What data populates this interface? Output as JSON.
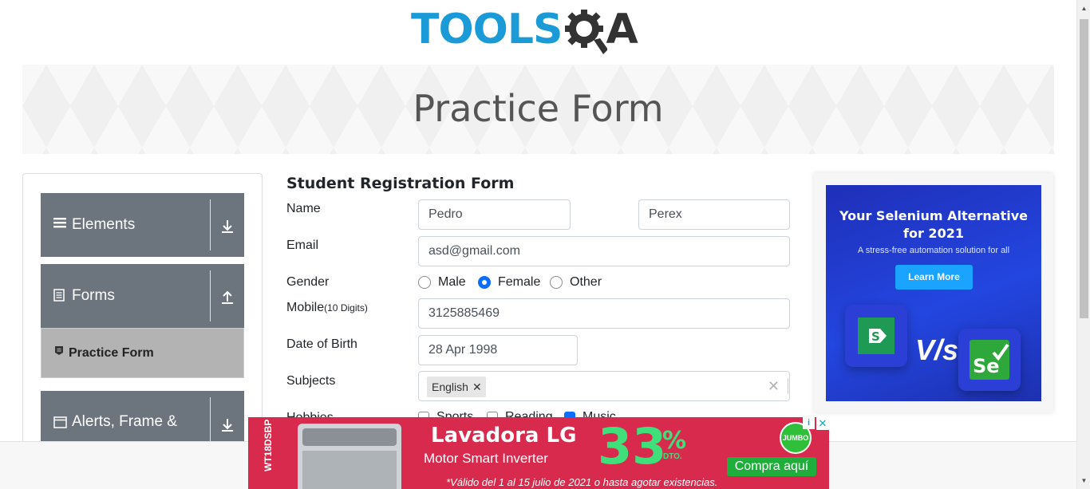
{
  "header": {
    "logo_tools": "TOOLS",
    "logo_a": "A"
  },
  "banner": {
    "title": "Practice Form"
  },
  "sidebar": {
    "groups": [
      {
        "label": "Elements",
        "icon": "hamburger-icon",
        "toggle": "download-icon"
      },
      {
        "label": "Forms",
        "icon": "document-icon",
        "toggle": "upload-icon"
      },
      {
        "label": "Alerts, Frame &",
        "icon": "window-icon",
        "toggle": "download-icon"
      }
    ],
    "active_item": {
      "label": "Practice Form",
      "icon": "form-icon"
    }
  },
  "form": {
    "title": "Student Registration Form",
    "name_label": "Name",
    "first_name": "Pedro",
    "last_name": "Perex",
    "email_label": "Email",
    "email": "asd@gmail.com",
    "gender_label": "Gender",
    "gender_options": [
      "Male",
      "Female",
      "Other"
    ],
    "gender_selected": "Female",
    "mobile_label": "Mobile",
    "mobile_hint": "(10 Digits)",
    "mobile": "3125885469",
    "dob_label": "Date of Birth",
    "dob": "28 Apr 1998",
    "subjects_label": "Subjects",
    "subjects": [
      "English"
    ],
    "hobbies_label": "Hobbies",
    "hobbies": [
      {
        "label": "Sports",
        "checked": false
      },
      {
        "label": "Reading",
        "checked": false
      },
      {
        "label": "Music",
        "checked": true
      }
    ]
  },
  "right_ad": {
    "headline_1": "Your Selenium Alternative",
    "headline_2": "for 2021",
    "tagline": "A stress-free automation solution for all",
    "cta": "Learn More",
    "vs": "V/s",
    "brand_color": "#2346e0"
  },
  "bottom_ad": {
    "side_text": "WT18DSBP",
    "title": "Lavadora LG",
    "subtitle": "Motor Smart Inverter",
    "percent": "33",
    "percent_sign": "%",
    "dto": "DTO.",
    "brand": "JUMBO",
    "cta": "Compra aquí",
    "fine_print": "*Válido del 1 al 15 julio de 2021 o hasta agotar existencias.",
    "bg_color": "#d82a4d",
    "accent_color": "#3fe07a"
  }
}
